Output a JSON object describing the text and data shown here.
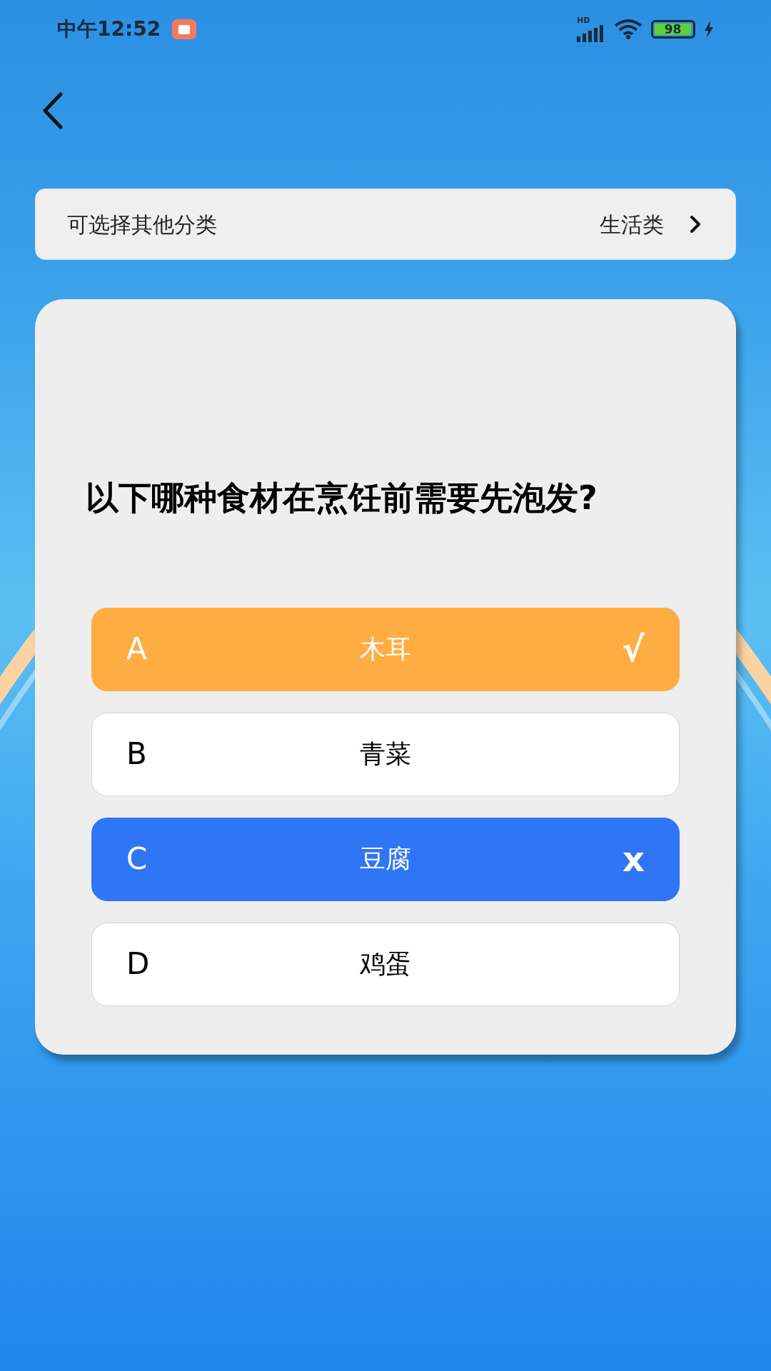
{
  "status_bar": {
    "time": "中午12:52",
    "network": "HD",
    "battery": "98"
  },
  "category_bar": {
    "label": "可选择其他分类",
    "value": "生活类"
  },
  "question": "以下哪种食材在烹饪前需要先泡发?",
  "options": [
    {
      "letter": "A",
      "text": "木耳",
      "kind": "correct",
      "mark": "√"
    },
    {
      "letter": "B",
      "text": "青菜",
      "kind": "plain"
    },
    {
      "letter": "C",
      "text": "豆腐",
      "kind": "wrong",
      "mark": "x"
    },
    {
      "letter": "D",
      "text": "鸡蛋",
      "kind": "plain"
    }
  ]
}
